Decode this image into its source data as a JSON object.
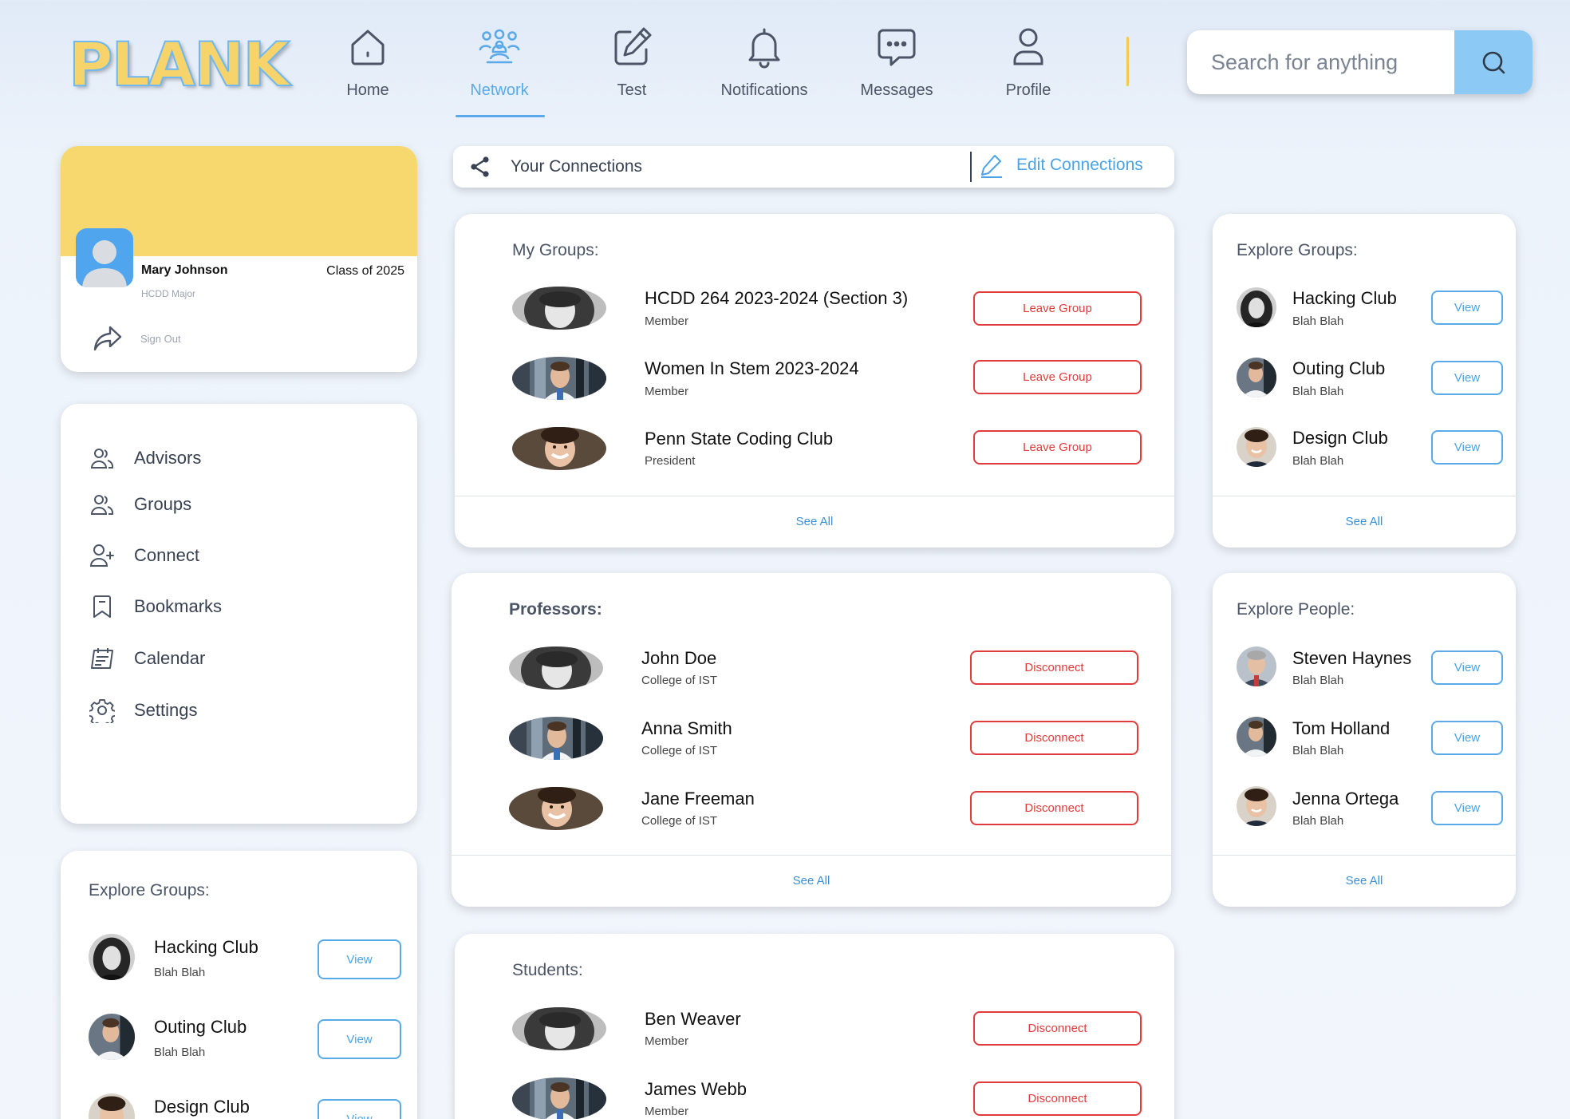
{
  "app": {
    "logo": "PLANK"
  },
  "nav": [
    {
      "label": "Home",
      "icon": "home-icon"
    },
    {
      "label": "Network",
      "icon": "network-icon",
      "active": true
    },
    {
      "label": "Test",
      "icon": "edit-icon"
    },
    {
      "label": "Notifications",
      "icon": "bell-icon"
    },
    {
      "label": "Messages",
      "icon": "chat-icon"
    },
    {
      "label": "Profile",
      "icon": "user-icon"
    }
  ],
  "search": {
    "placeholder": "Search for anything"
  },
  "profile": {
    "name": "Mary Johnson",
    "class_year": "Class of 2025",
    "major": "HCDD Major",
    "sign_out": "Sign Out"
  },
  "menu": [
    {
      "label": "Advisors",
      "icon": "users-icon"
    },
    {
      "label": "Groups",
      "icon": "users-icon"
    },
    {
      "label": "Connect",
      "icon": "user-plus-icon"
    },
    {
      "label": "Bookmarks",
      "icon": "bookmark-icon"
    },
    {
      "label": "Calendar",
      "icon": "calendar-icon"
    },
    {
      "label": "Settings",
      "icon": "gear-icon"
    }
  ],
  "connections": {
    "title": "Your Connections",
    "edit": "Edit Connections"
  },
  "my_groups": {
    "title": "My Groups:",
    "items": [
      {
        "name": "HCDD 264 2023-2024 (Section 3)",
        "role": "Member",
        "action": "Leave Group"
      },
      {
        "name": "Women In Stem 2023-2024",
        "role": "Member",
        "action": "Leave Group"
      },
      {
        "name": "Penn State Coding Club",
        "role": "President",
        "action": "Leave Group"
      }
    ],
    "see_all": "See All"
  },
  "professors": {
    "title": "Professors:",
    "items": [
      {
        "name": "John Doe",
        "role": "College of IST",
        "action": "Disconnect"
      },
      {
        "name": "Anna Smith",
        "role": "College of IST",
        "action": "Disconnect"
      },
      {
        "name": "Jane Freeman",
        "role": "College of IST",
        "action": "Disconnect"
      }
    ],
    "see_all": "See All"
  },
  "students": {
    "title": "Students:",
    "items": [
      {
        "name": "Ben Weaver",
        "role": "Member",
        "action": "Disconnect"
      },
      {
        "name": "James Webb",
        "role": "Member",
        "action": "Disconnect"
      }
    ]
  },
  "explore_groups_right": {
    "title": "Explore Groups:",
    "items": [
      {
        "name": "Hacking Club",
        "sub": "Blah Blah",
        "action": "View"
      },
      {
        "name": "Outing Club",
        "sub": "Blah Blah",
        "action": "View"
      },
      {
        "name": "Design Club",
        "sub": "Blah Blah",
        "action": "View"
      }
    ],
    "see_all": "See All"
  },
  "explore_people": {
    "title": "Explore People:",
    "items": [
      {
        "name": "Steven Haynes",
        "sub": "Blah Blah",
        "action": "View"
      },
      {
        "name": "Tom Holland",
        "sub": "Blah Blah",
        "action": "View"
      },
      {
        "name": "Jenna Ortega",
        "sub": "Blah Blah",
        "action": "View"
      }
    ],
    "see_all": "See All"
  },
  "explore_groups_left": {
    "title": "Explore Groups:",
    "items": [
      {
        "name": "Hacking Club",
        "sub": "Blah Blah",
        "action": "View"
      },
      {
        "name": "Outing Club",
        "sub": "Blah Blah",
        "action": "View"
      },
      {
        "name": "Design Club",
        "sub": "",
        "action": "View"
      }
    ]
  },
  "colors": {
    "accent": "#5aaaea",
    "banner": "#f6d86f",
    "danger": "#e23b3b"
  }
}
